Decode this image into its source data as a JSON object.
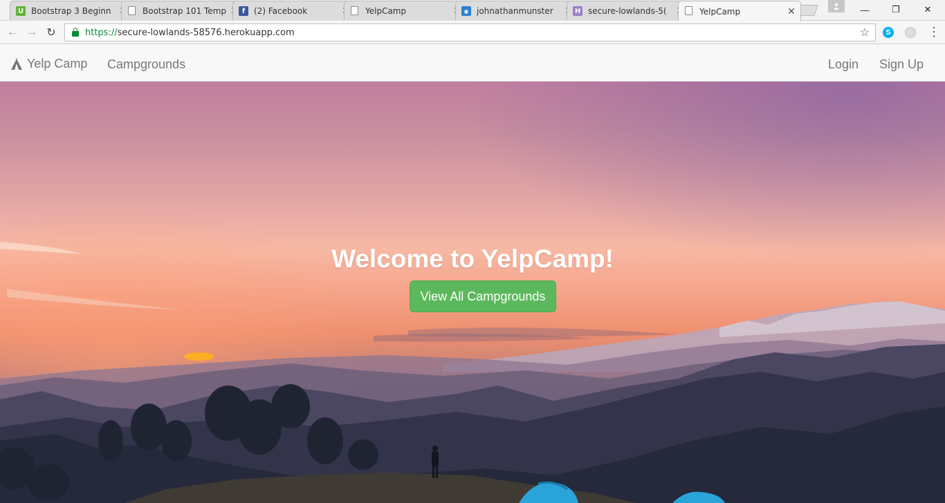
{
  "browser": {
    "tabs": [
      {
        "title": "Bootstrap 3 Beginn",
        "icon": "udemy-icon",
        "color": "#5fb336",
        "glyph": "U"
      },
      {
        "title": "Bootstrap 101 Temp",
        "icon": "page-icon"
      },
      {
        "title": "(2) Facebook",
        "icon": "facebook-icon",
        "color": "#3b5998",
        "glyph": "f"
      },
      {
        "title": "YelpCamp",
        "icon": "page-icon"
      },
      {
        "title": "johnathanmunster",
        "icon": "cloud9-icon",
        "color": "#2c7fd1",
        "glyph": "◉"
      },
      {
        "title": "secure-lowlands-5(",
        "icon": "heroku-icon",
        "color": "#9b7ec8",
        "glyph": "H"
      },
      {
        "title": "YelpCamp",
        "icon": "page-icon",
        "active": true
      }
    ],
    "tab_close_glyph": "✕",
    "url_scheme": "https://",
    "url_rest": "secure-lowlands-58576.herokuapp.com",
    "window_controls": {
      "minimize": "—",
      "restore": "❐",
      "close": "✕"
    }
  },
  "navbar": {
    "brand": "Yelp Camp",
    "links_left": [
      "Campgrounds"
    ],
    "links_right": [
      "Login",
      "Sign Up"
    ]
  },
  "hero": {
    "title": "Welcome to YelpCamp!",
    "button_label": "View All Campgrounds"
  },
  "colors": {
    "button_green": "#5cb85c",
    "navbar_bg": "#f8f8f8",
    "nav_text": "#777777"
  }
}
